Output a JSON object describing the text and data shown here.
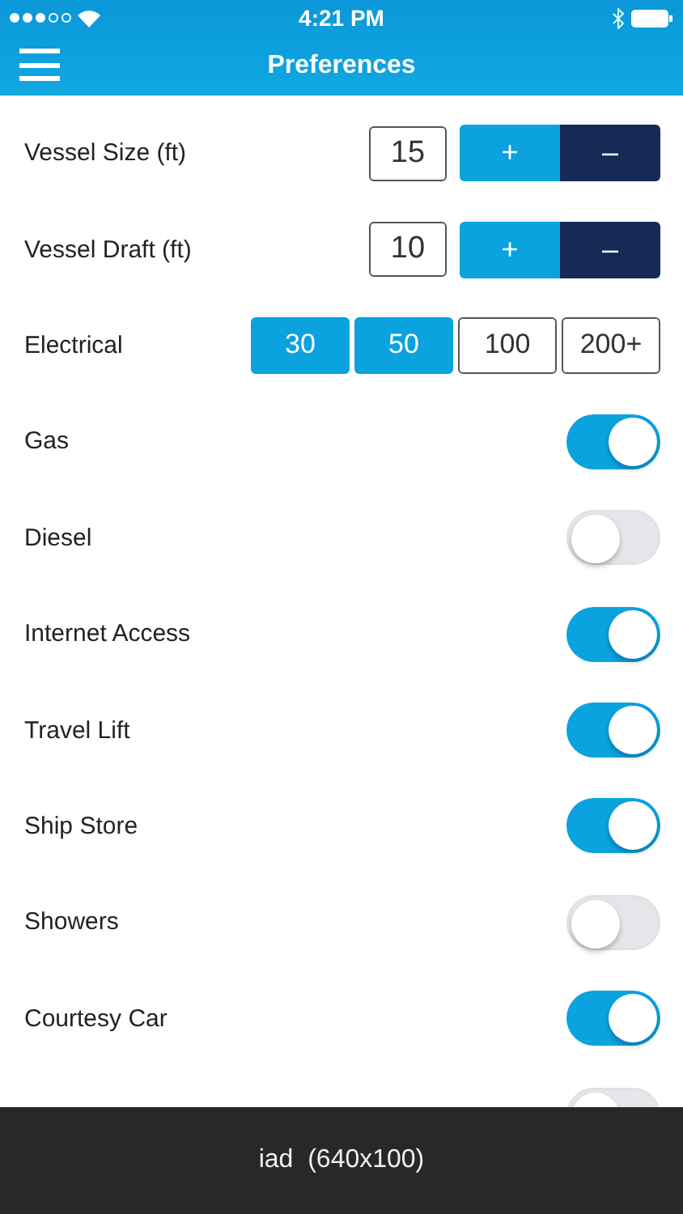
{
  "status_bar": {
    "time": "4:21 PM"
  },
  "nav": {
    "title": "Preferences"
  },
  "steppers": [
    {
      "label": "Vessel Size (ft)",
      "value": "15",
      "plus": "+",
      "minus": "–"
    },
    {
      "label": "Vessel Draft (ft)",
      "value": "10",
      "plus": "+",
      "minus": "–"
    }
  ],
  "electrical": {
    "label": "Electrical",
    "options": [
      {
        "label": "30",
        "selected": true
      },
      {
        "label": "50",
        "selected": true
      },
      {
        "label": "100",
        "selected": false
      },
      {
        "label": "200+",
        "selected": false
      }
    ]
  },
  "toggles": [
    {
      "label": "Gas",
      "on": true
    },
    {
      "label": "Diesel",
      "on": false
    },
    {
      "label": "Internet Access",
      "on": true
    },
    {
      "label": "Travel Lift",
      "on": true
    },
    {
      "label": "Ship Store",
      "on": true
    },
    {
      "label": "Showers",
      "on": false
    },
    {
      "label": "Courtesy Car",
      "on": true
    },
    {
      "on": false
    }
  ],
  "ad": {
    "text": "iad  (640x100)"
  }
}
